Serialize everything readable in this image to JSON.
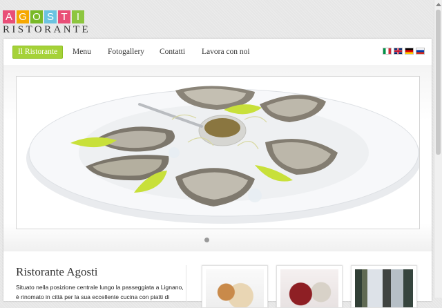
{
  "logo": {
    "letters": [
      "A",
      "G",
      "O",
      "S",
      "T",
      "I"
    ],
    "letter_colors": [
      "#e94e77",
      "#f6a800",
      "#79b927",
      "#6bc3e0",
      "#e94e77",
      "#8dc63f"
    ],
    "subtitle": "RISTORANTE"
  },
  "nav": {
    "items": [
      {
        "label": "Il Ristorante",
        "active": true
      },
      {
        "label": "Menu",
        "active": false
      },
      {
        "label": "Fotogallery",
        "active": false
      },
      {
        "label": "Contatti",
        "active": false
      },
      {
        "label": "Lavora con noi",
        "active": false
      }
    ],
    "languages": [
      "it",
      "en",
      "de",
      "ru"
    ]
  },
  "slider": {
    "current_slide": 1,
    "slide_count": 1
  },
  "intro": {
    "title": "Ristorante Agosti",
    "line1": "Situato nella posizione centrale lungo la passeggiata a Lignano,",
    "line2": "è rinomato in città per la sua eccellente cucina con piatti di"
  },
  "colors": {
    "accent": "#a5d238"
  }
}
